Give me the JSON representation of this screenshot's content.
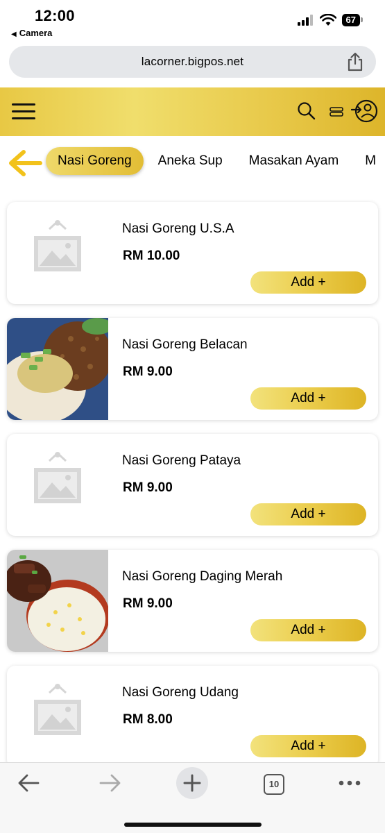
{
  "status_bar": {
    "time": "12:00",
    "back_app": "Camera",
    "battery": "67"
  },
  "browser": {
    "url": "lacorner.bigpos.net",
    "tab_count": "10"
  },
  "header": {
    "icons": [
      "menu-icon",
      "search-icon",
      "list-icon",
      "login-icon"
    ]
  },
  "categories": {
    "items": [
      {
        "label": "Nasi Goreng",
        "active": true
      },
      {
        "label": "Aneka Sup",
        "active": false
      },
      {
        "label": "Masakan Ayam",
        "active": false
      },
      {
        "label": "M",
        "active": false
      }
    ]
  },
  "products": [
    {
      "name": "Nasi Goreng U.S.A",
      "price": "RM 10.00",
      "add_label": "Add +",
      "image": "placeholder"
    },
    {
      "name": "Nasi Goreng Belacan",
      "price": "RM 9.00",
      "add_label": "Add +",
      "image": "photo"
    },
    {
      "name": "Nasi Goreng Pataya",
      "price": "RM 9.00",
      "add_label": "Add +",
      "image": "placeholder"
    },
    {
      "name": "Nasi Goreng Daging Merah",
      "price": "RM 9.00",
      "add_label": "Add +",
      "image": "photo"
    },
    {
      "name": "Nasi Goreng Udang",
      "price": "RM 8.00",
      "add_label": "Add +",
      "image": "placeholder"
    }
  ],
  "colors": {
    "accent": "#e8c844",
    "accent_dark": "#ddb52a",
    "arrow": "#f2c21b"
  }
}
